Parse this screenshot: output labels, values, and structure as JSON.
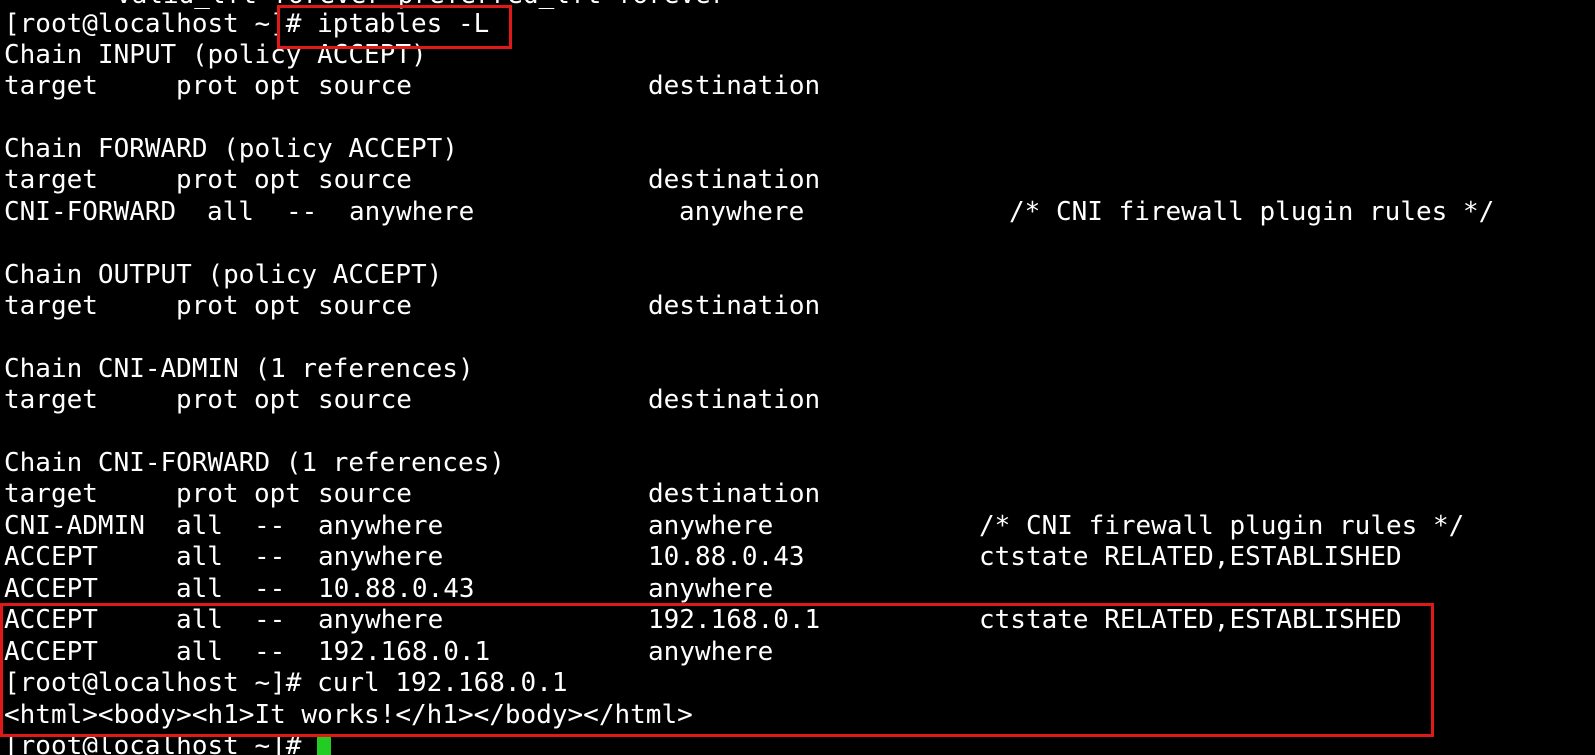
{
  "terminal": {
    "top_partial": "valid_lft forever preferred_lft forever",
    "prompt": "[root@localhost ~]",
    "command1": "# iptables -L",
    "header": {
      "target": "target",
      "prot": "prot",
      "opt": "opt",
      "source": "source",
      "destination": "destination"
    },
    "chains": {
      "input": "Chain INPUT (policy ACCEPT)",
      "forward": "Chain FORWARD (policy ACCEPT)",
      "output": "Chain OUTPUT (policy ACCEPT)",
      "cni_admin": "Chain CNI-ADMIN (1 references)",
      "cni_forward": "Chain CNI-FORWARD (1 references)"
    },
    "forward_rules": [
      {
        "target": "CNI-FORWARD",
        "prot": "all",
        "opt": "--",
        "source": "anywhere",
        "destination": "anywhere",
        "extra": "/* CNI firewall plugin rules */"
      }
    ],
    "cni_forward_rules": [
      {
        "target": "CNI-ADMIN",
        "prot": "all",
        "opt": "--",
        "source": "anywhere",
        "destination": "anywhere",
        "extra": "/* CNI firewall plugin rules */"
      },
      {
        "target": "ACCEPT",
        "prot": "all",
        "opt": "--",
        "source": "anywhere",
        "destination": "10.88.0.43",
        "extra": "ctstate RELATED,ESTABLISHED"
      },
      {
        "target": "ACCEPT",
        "prot": "all",
        "opt": "--",
        "source": "10.88.0.43",
        "destination": "anywhere",
        "extra": ""
      },
      {
        "target": "ACCEPT",
        "prot": "all",
        "opt": "--",
        "source": "anywhere",
        "destination": "192.168.0.1",
        "extra": "ctstate RELATED,ESTABLISHED"
      },
      {
        "target": "ACCEPT",
        "prot": "all",
        "opt": "--",
        "source": "192.168.0.1",
        "destination": "anywhere",
        "extra": ""
      }
    ],
    "command2_line": "[root@localhost ~]# curl 192.168.0.1",
    "curl_output": "<html><body><h1>It works!</h1></body></html>",
    "last_prompt": "[root@localhost ~]# "
  },
  "colors": {
    "background": "#000000",
    "text": "#ffffff",
    "highlight": "#e01818",
    "cursor": "#22cc22"
  }
}
